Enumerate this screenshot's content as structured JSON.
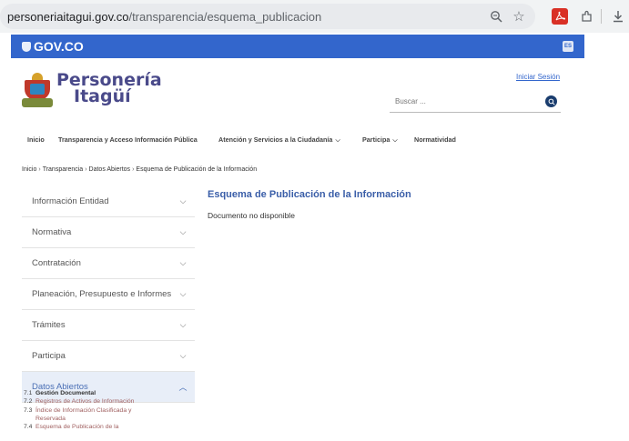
{
  "browser": {
    "url_domain": "personeriaitagui.gov.co",
    "url_path": "/transparencia/esquema_publicacion",
    "icons": [
      "zoom-icon",
      "star-icon",
      "pdf-icon",
      "extensions-icon",
      "download-icon"
    ]
  },
  "gov_bar": {
    "logo": "GOV.CO",
    "lang": "ES",
    "color": "#3366cc"
  },
  "header": {
    "brand_line1": "Personería",
    "brand_line2": "Itagüí",
    "login": "Iniciar Sesión",
    "search_placeholder": "Buscar ..."
  },
  "nav": {
    "items": [
      {
        "label": "Inicio"
      },
      {
        "label": "Transparencia y Acceso Información Pública"
      },
      {
        "label": "Atención y Servicios a la Ciudadanía"
      },
      {
        "label": "Participa"
      },
      {
        "label": "Normatividad"
      }
    ]
  },
  "breadcrumb": {
    "items": [
      "Inicio",
      "Transparencia",
      "Datos Abiertos",
      "Esquema de Publicación de la Información"
    ]
  },
  "sidebar": {
    "items": [
      {
        "label": "Información Entidad"
      },
      {
        "label": "Normativa"
      },
      {
        "label": "Contratación"
      },
      {
        "label": "Planeación, Presupuesto e Informes"
      },
      {
        "label": "Trámites"
      },
      {
        "label": "Participa"
      },
      {
        "label": "Datos Abiertos"
      }
    ],
    "sub_items": [
      {
        "num": "7.1",
        "label": "Gestión Documental"
      },
      {
        "num": "7.2",
        "label": "Registros de Activos de Información"
      },
      {
        "num": "7.3",
        "label": "Índice de Información Clasificada y"
      },
      {
        "num": "",
        "label": "Reservada"
      },
      {
        "num": "7.4",
        "label": "Esquema de Publicación de la"
      }
    ]
  },
  "content": {
    "title": "Esquema de Publicación de la Información",
    "message": "Documento no disponible"
  }
}
